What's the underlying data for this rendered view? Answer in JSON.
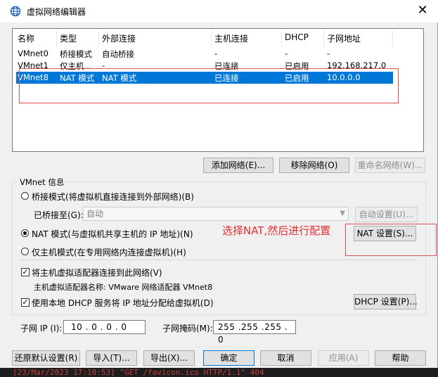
{
  "window": {
    "title": "虚拟网络编辑器",
    "close_glyph": "✕"
  },
  "netlist": {
    "columns": [
      "名称",
      "类型",
      "外部连接",
      "主机连接",
      "DHCP",
      "子网地址"
    ],
    "rows": [
      {
        "name": "VMnet0",
        "type": "桥接模式",
        "external": "自动桥接",
        "host": "-",
        "dhcp": "-",
        "subnet": "-"
      },
      {
        "name": "VMnet1",
        "type": "仅主机...",
        "external": "-",
        "host": "已连接",
        "dhcp": "已启用",
        "subnet": "192.168.217.0"
      },
      {
        "name": "VMnet8",
        "type": "NAT 模式",
        "external": "NAT 模式",
        "host": "已连接",
        "dhcp": "已启用",
        "subnet": "10.0.0.0"
      }
    ],
    "selected_row": 2
  },
  "list_buttons": {
    "add": "添加网络(E)...",
    "remove": "移除网络(O)",
    "rename": "重命名网络(W)..."
  },
  "vmnet_info": {
    "group_label": "VMnet 信息",
    "bridged_radio": "桥接模式(将虚拟机直接连接到外部网络)(B)",
    "bridged_to_label": "已桥接至(G):",
    "bridged_to_value": "自动",
    "auto_settings": "自动设置(U)...",
    "nat_radio": "NAT 模式(与虚拟机共享主机的 IP 地址)(N)",
    "nat_settings": "NAT 设置(S)...",
    "hostonly_radio": "仅主机模式(在专用网络内连接虚拟机)(H)",
    "connect_adapter_check": "将主机虚拟适配器连接到此网络(V)",
    "adapter_name": "主机虚拟适配器名称: VMware 网络适配器 VMnet8",
    "dhcp_check": "使用本地 DHCP 服务将 IP 地址分配给虚拟机(D)",
    "dhcp_settings": "DHCP 设置(P)...",
    "subnet_ip_label": "子网 IP (I):",
    "subnet_ip_value": "10 . 0 . 0 . 0",
    "mask_label": "子网掩码(M):",
    "mask_value": "255 .255 .255 . 0",
    "selected_mode": "nat"
  },
  "annotation": {
    "text": "选择NAT,然后进行配置",
    "color": "#e03030"
  },
  "bottom_buttons": {
    "restore": "还原默认设置(R)",
    "import": "导入(T)...",
    "export": "导出(X)...",
    "ok": "确定",
    "cancel": "取消",
    "apply": "应用(A)",
    "help": "帮助"
  },
  "terminal": {
    "line": "[23/Mar/2023 17:10:53] \"GET /favicon.ico HTTP/1.1\" 404"
  },
  "colors": {
    "selection": "#0078d7",
    "accent_red": "#e03030"
  }
}
